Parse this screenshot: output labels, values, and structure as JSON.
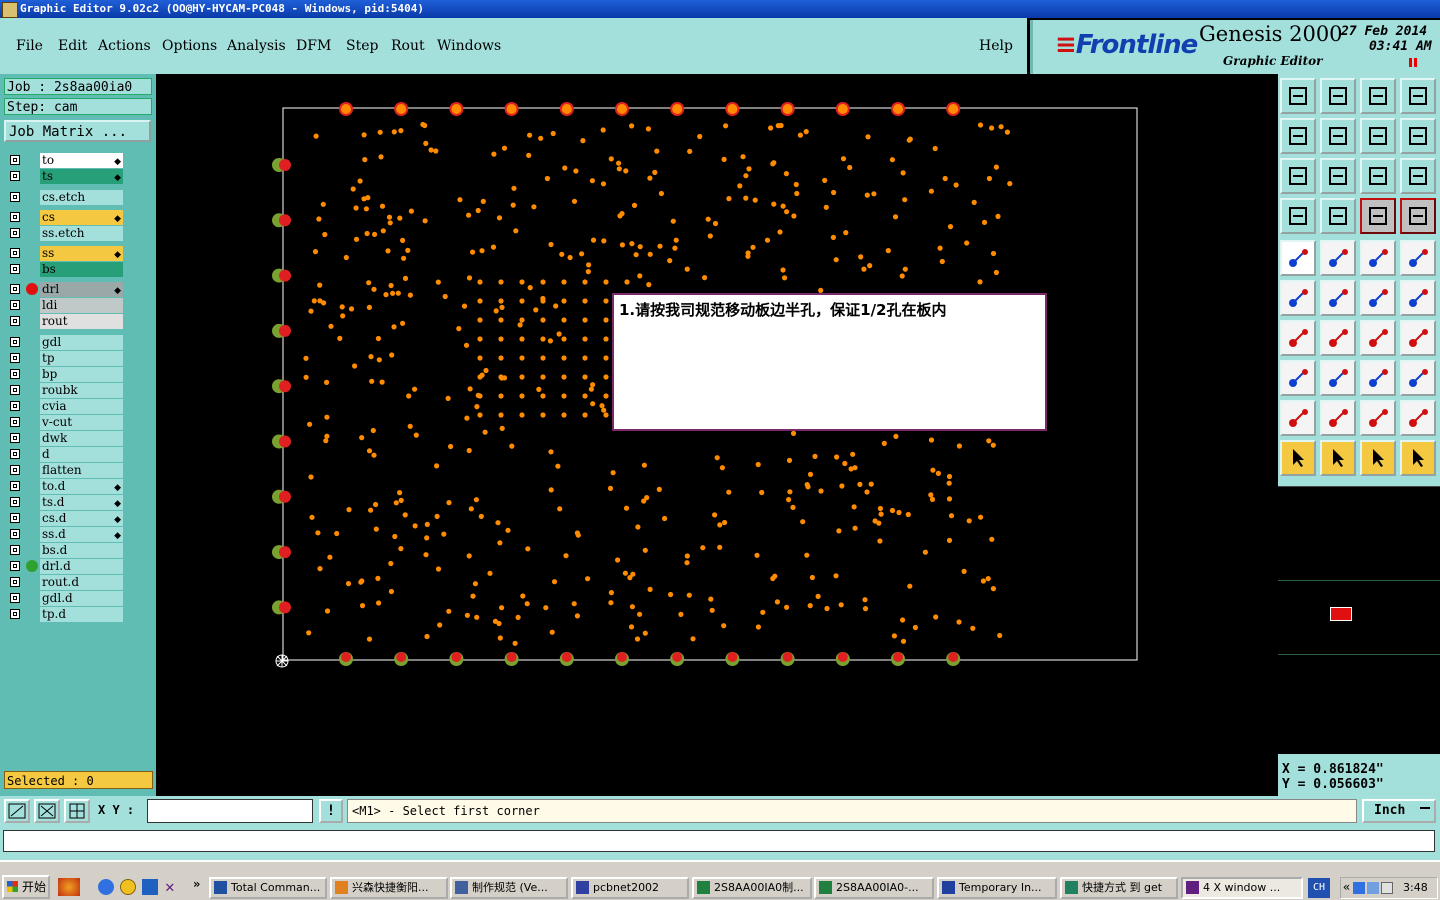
{
  "window": {
    "title": "Graphic Editor 9.02c2 (OO@HY-HYCAM-PC048 - Windows, pid:5404)"
  },
  "menu": {
    "items": [
      "File",
      "Edit",
      "Actions",
      "Options",
      "Analysis",
      "DFM",
      "Step",
      "Rout",
      "Windows"
    ],
    "help": "Help"
  },
  "brand": {
    "logo": "Frontline",
    "product": "Genesis 2000",
    "subtitle": "Graphic Editor",
    "date": "27 Feb 2014",
    "time": "03:41 AM"
  },
  "job": {
    "job_text": "Job : 2s8aa00ia0",
    "step_text": "Step: cam",
    "matrix_label": "Job Matrix ..."
  },
  "layers": [
    {
      "name": "to",
      "color": "#ffffff",
      "mark": true
    },
    {
      "name": "ts",
      "color": "#27a07a",
      "mark": true
    },
    {
      "name": "cs.etch",
      "color": "#a3dfdb",
      "mark": false
    },
    {
      "name": "cs",
      "color": "#f5c842",
      "mark": true
    },
    {
      "name": "ss.etch",
      "color": "#a3dfdb",
      "mark": false
    },
    {
      "name": "ss",
      "color": "#f5c842",
      "mark": true
    },
    {
      "name": "bs",
      "color": "#27a07a",
      "mark": false
    },
    {
      "name": "drl",
      "color": "#9aa8a8",
      "mark": true,
      "dot": "#e01010"
    },
    {
      "name": "ldi",
      "color": "#c0c8c8",
      "mark": false
    },
    {
      "name": "rout",
      "color": "#e0e0e0",
      "mark": false
    },
    {
      "name": "gdl",
      "color": "#a3dfdb",
      "mark": false
    },
    {
      "name": "tp",
      "color": "#a3dfdb",
      "mark": false
    },
    {
      "name": "bp",
      "color": "#a3dfdb",
      "mark": false
    },
    {
      "name": "roubk",
      "color": "#a3dfdb",
      "mark": false
    },
    {
      "name": "cvia",
      "color": "#a3dfdb",
      "mark": false
    },
    {
      "name": "v-cut",
      "color": "#a3dfdb",
      "mark": false
    },
    {
      "name": "dwk",
      "color": "#a3dfdb",
      "mark": false
    },
    {
      "name": "d",
      "color": "#a3dfdb",
      "mark": false
    },
    {
      "name": "flatten",
      "color": "#a3dfdb",
      "mark": false
    },
    {
      "name": "to.d",
      "color": "#a3dfdb",
      "mark": true
    },
    {
      "name": "ts.d",
      "color": "#a3dfdb",
      "mark": true
    },
    {
      "name": "cs.d",
      "color": "#a3dfdb",
      "mark": true
    },
    {
      "name": "ss.d",
      "color": "#a3dfdb",
      "mark": true
    },
    {
      "name": "bs.d",
      "color": "#a3dfdb",
      "mark": false
    },
    {
      "name": "drl.d",
      "color": "#a3dfdb",
      "mark": false,
      "dot": "#30a030"
    },
    {
      "name": "rout.d",
      "color": "#a3dfdb",
      "mark": false
    },
    {
      "name": "gdl.d",
      "color": "#a3dfdb",
      "mark": false
    },
    {
      "name": "tp.d",
      "color": "#a3dfdb",
      "mark": false
    }
  ],
  "selected_text": "Selected : 0",
  "dialog": {
    "message": "1.请按我司规范移动板边半孔，保证1/2孔在板内"
  },
  "coords": {
    "x": "X = 0.861824\"",
    "y": "Y = 0.056603\""
  },
  "statusbar": {
    "xy_label": "X Y :",
    "xy_value": "",
    "prompt": "<M1> - Select first corner",
    "units": "Inch"
  },
  "taskbar": {
    "start": "开始",
    "tasks": [
      "Total Comman...",
      "兴森快捷衡阳...",
      "制作规范 (Ve...",
      "pcbnet2002",
      "2S8AA00IA0制...",
      "2S8AA00IA0-...",
      "Temporary In...",
      "快捷方式 到 get",
      "4 X window ..."
    ],
    "lang": "CH",
    "clock": "3:48"
  },
  "colors": {
    "teal": "#a3dfdb",
    "panel": "#5fbdb4",
    "pad_orange": "#ff8c00",
    "pad_red": "#e02020",
    "pad_green": "#7aa030"
  }
}
